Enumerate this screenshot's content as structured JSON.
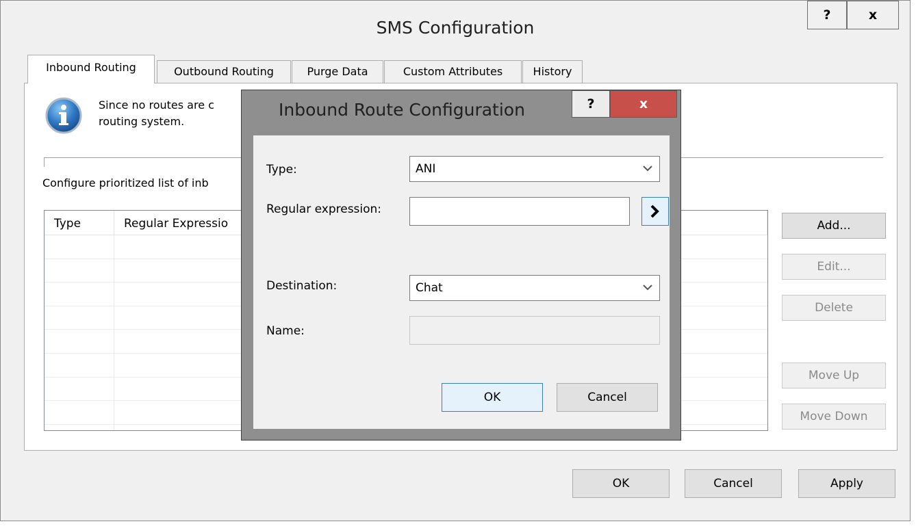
{
  "window": {
    "title": "SMS Configuration",
    "help_label": "?",
    "close_label": "x"
  },
  "tabs": [
    {
      "label": "Inbound Routing",
      "active": true
    },
    {
      "label": "Outbound Routing"
    },
    {
      "label": "Purge Data"
    },
    {
      "label": "Custom Attributes"
    },
    {
      "label": "History"
    }
  ],
  "panel": {
    "info_line1": "Since no routes are c",
    "info_line2": "routing system.",
    "configure_label": "Configure prioritized list of inb",
    "table": {
      "columns": [
        "Type",
        "Regular Expressio"
      ]
    },
    "buttons": {
      "add": "Add...",
      "edit": "Edit...",
      "delete": "Delete",
      "move_up": "Move Up",
      "move_down": "Move Down"
    }
  },
  "footer": {
    "ok": "OK",
    "cancel": "Cancel",
    "apply": "Apply"
  },
  "dialog": {
    "title": "Inbound Route Configuration",
    "help_label": "?",
    "close_label": "x",
    "type_label": "Type:",
    "type_value": "ANI",
    "regex_label": "Regular expression:",
    "regex_value": "",
    "destination_label": "Destination:",
    "destination_value": "Chat",
    "name_label": "Name:",
    "name_value": "",
    "ok": "OK",
    "cancel": "Cancel"
  },
  "colors": {
    "accent_border": "#3c7fb1",
    "close_red": "#c7504a",
    "info_blue": "#2f78c4"
  }
}
